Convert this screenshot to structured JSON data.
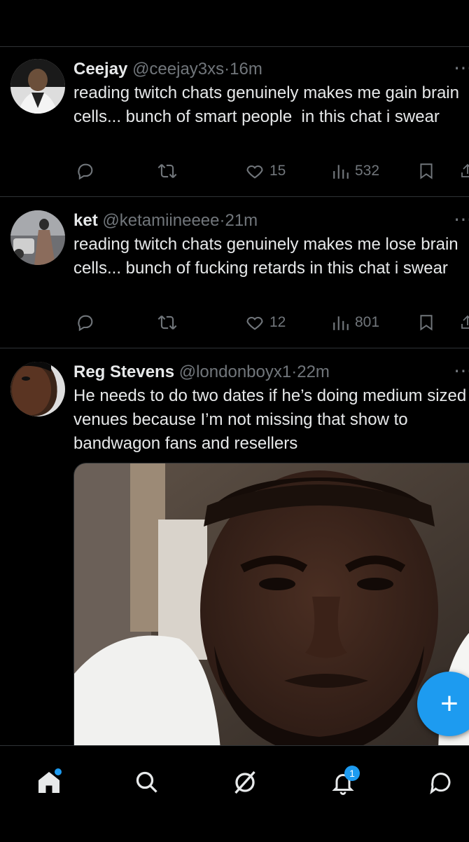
{
  "tweets": [
    {
      "name": "Ceejay",
      "handle": "@ceejay3xs",
      "time": "16m",
      "text": "reading twitch chats genuinely makes me gain brain cells... bunch of smart people  in this chat i swear",
      "likes": "15",
      "views": "532"
    },
    {
      "name": "ket",
      "handle": "@ketamiineeee",
      "time": "21m",
      "text": "reading twitch chats genuinely makes me lose brain cells... bunch of fucking retards in this chat i swear",
      "likes": "12",
      "views": "801"
    },
    {
      "name": "Reg Stevens",
      "handle": "@londonboyx1",
      "time": "22m",
      "text": "He needs to do two dates if he’s doing medium sized venues because I’m not missing that show to bandwagon fans and resellers"
    }
  ],
  "dot": "·",
  "nav": {
    "notifications_count": "1"
  },
  "fab_label": "+",
  "colors": {
    "accent": "#1d9bf0",
    "muted": "#71767b",
    "text": "#e7e9ea",
    "background": "#000000"
  }
}
